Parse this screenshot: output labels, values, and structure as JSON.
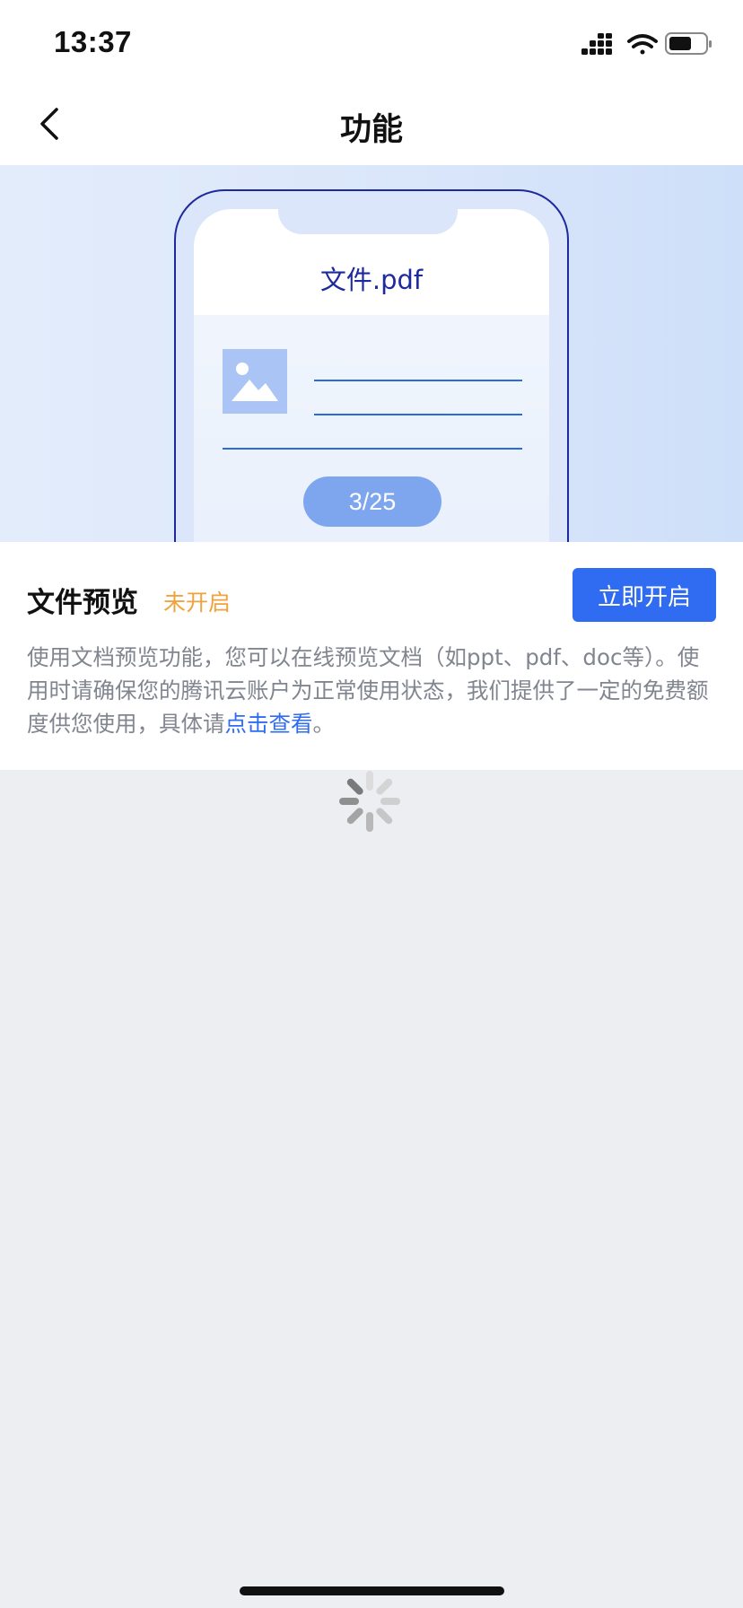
{
  "status_bar": {
    "time": "13:37",
    "icons": [
      "cellular-signal-icon",
      "wifi-icon",
      "battery-icon"
    ]
  },
  "nav": {
    "title": "功能",
    "back_icon": "chevron-left-icon"
  },
  "hero": {
    "file_name": "文件.pdf",
    "page_indicator": "3/25",
    "image_icon": "image-placeholder-icon"
  },
  "feature": {
    "name": "文件预览",
    "status": "未开启",
    "button_label": "立即开启",
    "description": "使用文档预览功能，您可以在线预览文档（如ppt、pdf、doc等）。使用时请确保您的腾讯云账户为正常使用状态，我们提供了一定的免费额度供您使用，具体请",
    "link_text": "点击查看",
    "description_end": "。"
  },
  "colors": {
    "accent": "#2f6cf2",
    "status_warning": "#f0a23c",
    "page_background": "#eceef2",
    "hero_navy": "#1d2a9e"
  },
  "loading_icon": "loading-spinner-icon"
}
